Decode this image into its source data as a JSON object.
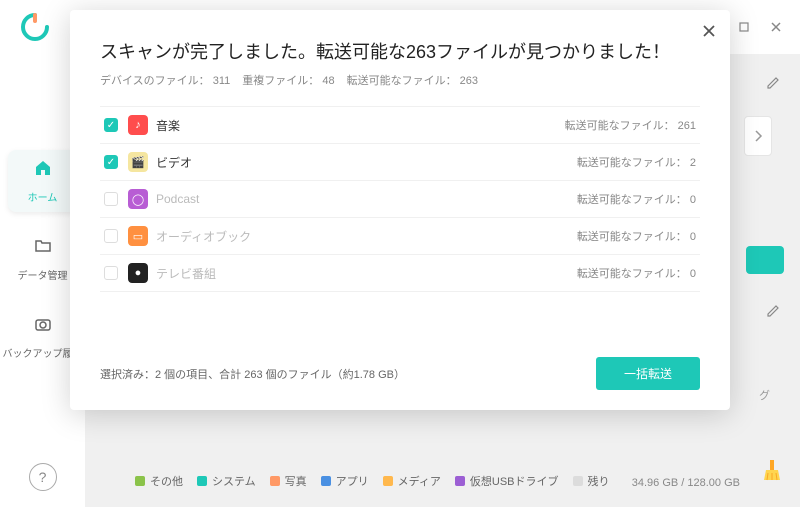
{
  "titlebar": {
    "edit_icon": "edit-icon"
  },
  "sidebar": {
    "items": [
      {
        "label": "ホーム"
      },
      {
        "label": "データ管理"
      },
      {
        "label": "バックアップ履歴"
      }
    ],
    "help": "?"
  },
  "background": {
    "partial_text": "グ"
  },
  "storage": {
    "legend": [
      {
        "label": "その他",
        "color": "#8bc34a"
      },
      {
        "label": "システム",
        "color": "#1ec8b7"
      },
      {
        "label": "写真",
        "color": "#ff9966"
      },
      {
        "label": "アプリ",
        "color": "#4a90e2"
      },
      {
        "label": "メディア",
        "color": "#ffb84d"
      },
      {
        "label": "仮想USBドライブ",
        "color": "#9c5fd4"
      },
      {
        "label": "残り",
        "color": "#dcdcdc"
      }
    ],
    "used": "34.96 GB",
    "total": "128.00 GB",
    "text": "34.96 GB / 128.00 GB"
  },
  "modal": {
    "title": "スキャンが完了しました。転送可能な263ファイルが見つかりました！",
    "sub": {
      "device_files_label": "デバイスのファイル：",
      "device_files": "311",
      "dup_label": "重複ファイル：",
      "dup": "48",
      "transferable_label": "転送可能なファイル：",
      "transferable": "263"
    },
    "count_prefix": "転送可能なファイル：",
    "categories": [
      {
        "checked": true,
        "icon_color": "#ff4d4d",
        "icon": "♪",
        "label": "音楽",
        "count": "261"
      },
      {
        "checked": true,
        "icon_color": "#f5e6a0",
        "icon": "🎬",
        "label": "ビデオ",
        "count": "2"
      },
      {
        "checked": false,
        "icon_color": "#b85dd4",
        "icon": "◯",
        "label": "Podcast",
        "count": "0"
      },
      {
        "checked": false,
        "icon_color": "#ff9040",
        "icon": "▭",
        "label": "オーディオブック",
        "count": "0"
      },
      {
        "checked": false,
        "icon_color": "#222222",
        "icon": "●",
        "label": "テレビ番組",
        "count": "0"
      }
    ],
    "summary": "選択済み：2 個の項目、合計 263 個のファイル（約1.78 GB）",
    "transfer_button": "一括転送"
  }
}
